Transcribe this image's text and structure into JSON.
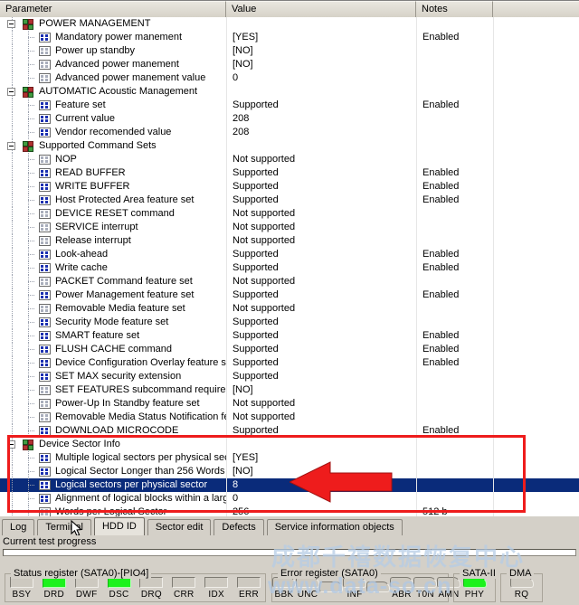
{
  "columns": {
    "parameter": "Parameter",
    "value": "Value",
    "notes": "Notes"
  },
  "rows": [
    {
      "type": "group",
      "indent": 0,
      "label": "POWER MANAGEMENT",
      "value": "",
      "notes": ""
    },
    {
      "type": "leaf",
      "indent": 1,
      "icon": "on",
      "label": "Mandatory power manement",
      "value": "[YES]",
      "notes": "Enabled"
    },
    {
      "type": "leaf",
      "indent": 1,
      "icon": "off",
      "label": "Power up standby",
      "value": "[NO]",
      "notes": ""
    },
    {
      "type": "leaf",
      "indent": 1,
      "icon": "off",
      "label": "Advanced power manement",
      "value": "[NO]",
      "notes": ""
    },
    {
      "type": "leaf",
      "indent": 1,
      "icon": "off",
      "label": "Advanced power manement value",
      "value": "0",
      "notes": ""
    },
    {
      "type": "group",
      "indent": 0,
      "label": "AUTOMATIC Acoustic Management",
      "value": "",
      "notes": ""
    },
    {
      "type": "leaf",
      "indent": 1,
      "icon": "on",
      "label": "Feature set",
      "value": "Supported",
      "notes": "Enabled"
    },
    {
      "type": "leaf",
      "indent": 1,
      "icon": "on",
      "label": "Current value",
      "value": "208",
      "notes": ""
    },
    {
      "type": "leaf",
      "indent": 1,
      "icon": "on",
      "label": "Vendor recomended value",
      "value": "208",
      "notes": ""
    },
    {
      "type": "group",
      "indent": 0,
      "label": "Supported Command Sets",
      "value": "",
      "notes": ""
    },
    {
      "type": "leaf",
      "indent": 1,
      "icon": "off",
      "label": "NOP",
      "value": "Not supported",
      "notes": ""
    },
    {
      "type": "leaf",
      "indent": 1,
      "icon": "on",
      "label": "READ BUFFER",
      "value": "Supported",
      "notes": "Enabled"
    },
    {
      "type": "leaf",
      "indent": 1,
      "icon": "on",
      "label": "WRITE BUFFER",
      "value": "Supported",
      "notes": "Enabled"
    },
    {
      "type": "leaf",
      "indent": 1,
      "icon": "on",
      "label": "Host Protected Area feature set",
      "value": "Supported",
      "notes": "Enabled"
    },
    {
      "type": "leaf",
      "indent": 1,
      "icon": "off",
      "label": "DEVICE RESET command",
      "value": "Not supported",
      "notes": ""
    },
    {
      "type": "leaf",
      "indent": 1,
      "icon": "off",
      "label": "SERVICE interrupt",
      "value": "Not supported",
      "notes": ""
    },
    {
      "type": "leaf",
      "indent": 1,
      "icon": "off",
      "label": "Release interrupt",
      "value": "Not supported",
      "notes": ""
    },
    {
      "type": "leaf",
      "indent": 1,
      "icon": "on",
      "label": "Look-ahead",
      "value": "Supported",
      "notes": "Enabled"
    },
    {
      "type": "leaf",
      "indent": 1,
      "icon": "on",
      "label": "Write cache",
      "value": "Supported",
      "notes": "Enabled"
    },
    {
      "type": "leaf",
      "indent": 1,
      "icon": "off",
      "label": "PACKET Command feature set",
      "value": "Not supported",
      "notes": ""
    },
    {
      "type": "leaf",
      "indent": 1,
      "icon": "on",
      "label": "Power Management feature set",
      "value": "Supported",
      "notes": "Enabled"
    },
    {
      "type": "leaf",
      "indent": 1,
      "icon": "off",
      "label": "Removable Media feature set",
      "value": "Not supported",
      "notes": ""
    },
    {
      "type": "leaf",
      "indent": 1,
      "icon": "on",
      "label": "Security Mode feature set",
      "value": "Supported",
      "notes": ""
    },
    {
      "type": "leaf",
      "indent": 1,
      "icon": "on",
      "label": "SMART feature set",
      "value": "Supported",
      "notes": "Enabled"
    },
    {
      "type": "leaf",
      "indent": 1,
      "icon": "on",
      "label": "FLUSH CACHE command",
      "value": "Supported",
      "notes": "Enabled"
    },
    {
      "type": "leaf",
      "indent": 1,
      "icon": "on",
      "label": "Device Configuration Overlay feature set",
      "value": "Supported",
      "notes": "Enabled"
    },
    {
      "type": "leaf",
      "indent": 1,
      "icon": "on",
      "label": "SET MAX security extension",
      "value": "Supported",
      "notes": ""
    },
    {
      "type": "leaf",
      "indent": 1,
      "icon": "off",
      "label": "SET FEATURES subcommand required to spinu...",
      "value": "[NO]",
      "notes": ""
    },
    {
      "type": "leaf",
      "indent": 1,
      "icon": "off",
      "label": "Power-Up In Standby feature set",
      "value": "Not supported",
      "notes": ""
    },
    {
      "type": "leaf",
      "indent": 1,
      "icon": "off",
      "label": "Removable Media Status Notification feature set",
      "value": "Not supported",
      "notes": ""
    },
    {
      "type": "leaf",
      "indent": 1,
      "icon": "on",
      "label": "DOWNLOAD MICROCODE",
      "value": "Supported",
      "notes": "Enabled"
    },
    {
      "type": "group",
      "indent": 0,
      "label": "Device Sector Info",
      "value": "",
      "notes": ""
    },
    {
      "type": "leaf",
      "indent": 1,
      "icon": "on",
      "label": "Multiple logical sectors per physical sector",
      "value": "[YES]",
      "notes": ""
    },
    {
      "type": "leaf",
      "indent": 1,
      "icon": "on",
      "label": "Logical Sector Longer than 256 Words",
      "value": "[NO]",
      "notes": ""
    },
    {
      "type": "leaf",
      "indent": 1,
      "icon": "on",
      "label": "Logical sectors per physical sector",
      "value": "8",
      "notes": "",
      "selected": true
    },
    {
      "type": "leaf",
      "indent": 1,
      "icon": "on",
      "label": "Alignment of logical blocks within a larger phys...",
      "value": "0",
      "notes": ""
    },
    {
      "type": "leaf",
      "indent": 1,
      "icon": "off",
      "label": "Words per Logical Sector",
      "value": "256",
      "notes": "512 b"
    }
  ],
  "tabs": [
    {
      "label": "Log",
      "active": false
    },
    {
      "label": "Terminal",
      "active": false
    },
    {
      "label": "HDD ID",
      "active": true
    },
    {
      "label": "Sector edit",
      "active": false
    },
    {
      "label": "Defects",
      "active": false
    },
    {
      "label": "Service information objects",
      "active": false
    }
  ],
  "progress": {
    "label": "Current test progress",
    "percent": 0
  },
  "status_register": {
    "title": "Status register (SATA0)-[PIO4]",
    "leds": [
      {
        "label": "BSY",
        "on": false
      },
      {
        "label": "DRD",
        "on": true
      },
      {
        "label": "DWF",
        "on": false
      },
      {
        "label": "DSC",
        "on": true
      },
      {
        "label": "DRQ",
        "on": false
      },
      {
        "label": "CRR",
        "on": false
      },
      {
        "label": "IDX",
        "on": false
      },
      {
        "label": "ERR",
        "on": false
      }
    ]
  },
  "error_register": {
    "title": "Error register (SATA0)",
    "leds": [
      {
        "label": "BBK",
        "on": false
      },
      {
        "label": "UNC",
        "on": false
      },
      {
        "label": "",
        "on": false
      },
      {
        "label": "INF",
        "on": false
      },
      {
        "label": "",
        "on": false
      },
      {
        "label": "ABR",
        "on": false
      },
      {
        "label": "T0N",
        "on": false
      },
      {
        "label": "AMN",
        "on": false
      }
    ]
  },
  "sata_panel": {
    "title": "SATA-II",
    "led": {
      "label": "PHY",
      "on": true
    }
  },
  "dma_panel": {
    "title": "DMA",
    "led": {
      "label": "RQ",
      "on": false
    }
  },
  "watermarks": {
    "chinese": "成都千禧数据恢复中心",
    "url": "www.data-so.cn"
  },
  "colors": {
    "selection": "#0a2b7a",
    "annotation_red": "#ee1c1c",
    "led_on": "#1cf21c",
    "panel_bg": "#d4d0c8"
  }
}
